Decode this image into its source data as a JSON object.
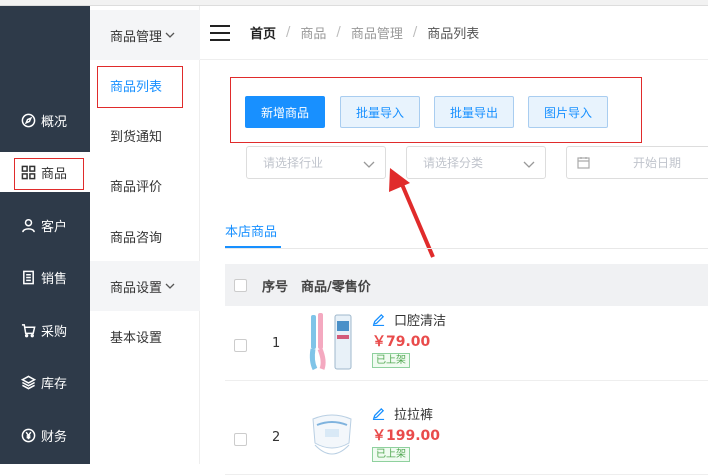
{
  "leftnav": {
    "items": [
      {
        "label": "概况",
        "icon": "compass-icon"
      },
      {
        "label": "商品",
        "icon": "grid-icon"
      },
      {
        "label": "客户",
        "icon": "user-icon"
      },
      {
        "label": "销售",
        "icon": "document-icon"
      },
      {
        "label": "采购",
        "icon": "cart-icon"
      },
      {
        "label": "库存",
        "icon": "layers-icon"
      },
      {
        "label": "财务",
        "icon": "yen-icon"
      }
    ],
    "active_index": 1
  },
  "subnav": {
    "group1": "商品管理",
    "items": [
      "商品列表",
      "到货通知",
      "商品评价",
      "商品咨询"
    ],
    "group2": "商品设置",
    "items2": [
      "基本设置"
    ]
  },
  "breadcrumb": [
    "首页",
    "商品",
    "商品管理",
    "商品列表"
  ],
  "toolbar": {
    "add": "新增商品",
    "batch_import": "批量导入",
    "batch_export": "批量导出",
    "image_import": "图片导入"
  },
  "filters": {
    "industry_placeholder": "请选择行业",
    "category_placeholder": "请选择分类",
    "start_date_placeholder": "开始日期"
  },
  "tab": "本店商品",
  "table": {
    "col_index": "序号",
    "col_product": "商品/零售价",
    "rows": [
      {
        "index": "1",
        "name": "口腔清洁",
        "price": "￥79.00",
        "status": "已上架"
      },
      {
        "index": "2",
        "name": "拉拉裤",
        "price": "￥199.00",
        "status": "已上架"
      }
    ]
  },
  "colors": {
    "accent": "#1890ff",
    "price": "#e94b4b",
    "annotation": "#e02b2b",
    "nav_bg": "#2e3a49"
  }
}
